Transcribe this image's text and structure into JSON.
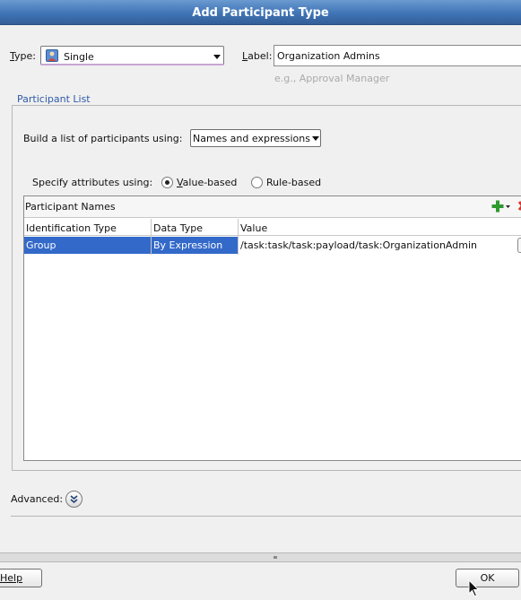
{
  "dialog": {
    "title": "Add Participant Type"
  },
  "type_field": {
    "label_prefix": "T",
    "label_rest": "ype:",
    "value": "Single"
  },
  "label_field": {
    "label_prefix": "L",
    "label_rest": "abel:",
    "value": "Organization Admins",
    "hint": "e.g., Approval Manager"
  },
  "participant_list": {
    "legend": "Participant List",
    "build_label": "Build a list of participants using:",
    "build_value": "Names and expressions",
    "specify_label": "Specify attributes using:",
    "radio_value_prefix": "V",
    "radio_value_rest": "alue-based",
    "radio_rule": "Rule-based",
    "selected_radio": "Value-based"
  },
  "table": {
    "title": "Participant Names",
    "columns": [
      "Identification Type",
      "Data Type",
      "Value"
    ],
    "rows": [
      {
        "identification_type": "Group",
        "data_type": "By Expression",
        "value": "/task:task/task:payload/task:OrganizationAdmin"
      }
    ]
  },
  "advanced": {
    "label": "Advanced:"
  },
  "buttons": {
    "help": "Help",
    "ok": "OK"
  },
  "colors": {
    "accent": "#3369c9",
    "titlebar": "#3f74b6",
    "legend": "#2f5aa8"
  }
}
